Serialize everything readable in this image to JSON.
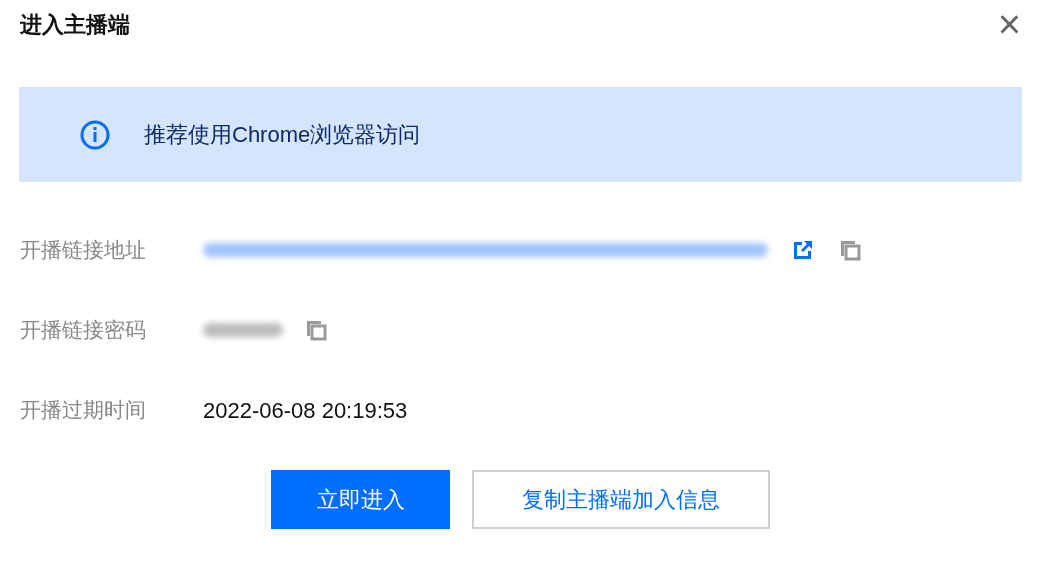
{
  "dialog": {
    "title": "进入主播端",
    "close": "×"
  },
  "notice": {
    "text": "推荐使用Chrome浏览器访问"
  },
  "fields": [
    {
      "kind": "link",
      "label": "开播链接地址"
    },
    {
      "kind": "secret",
      "label": "开播链接密码"
    },
    {
      "kind": "text",
      "label": "开播过期时间",
      "value": "2022-06-08 20:19:53"
    }
  ],
  "buttons": [
    {
      "label": "立即进入",
      "kind": "primary"
    },
    {
      "label": "复制主播端加入信息",
      "kind": "secondary"
    }
  ]
}
